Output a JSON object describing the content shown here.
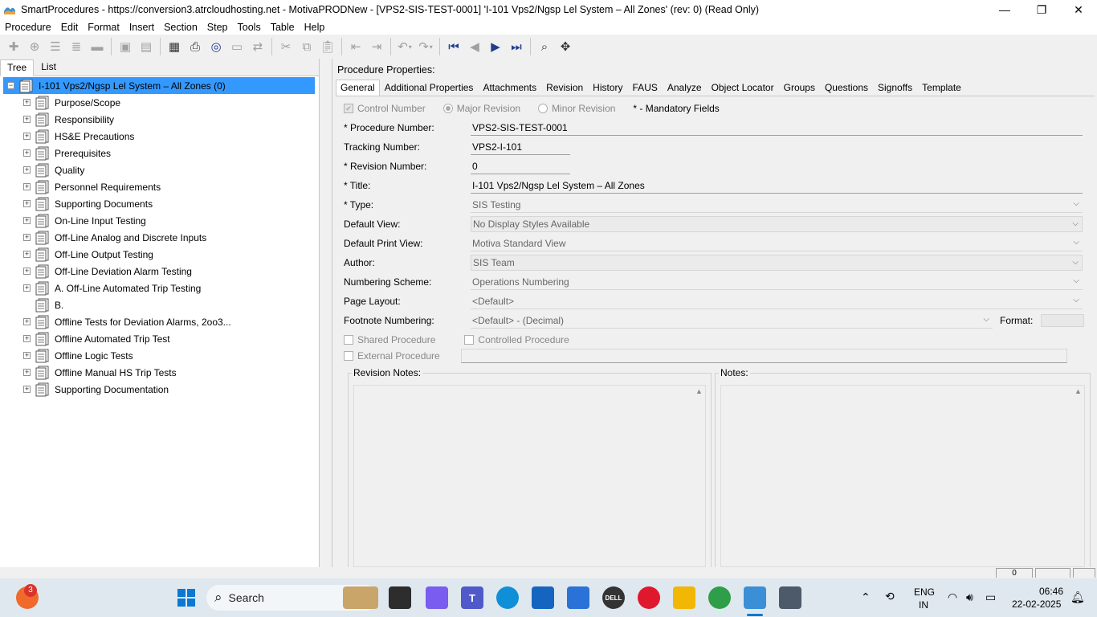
{
  "window": {
    "title": "SmartProcedures - https://conversion3.atrcloudhosting.net - MotivaPRODNew - [VPS2-SIS-TEST-0001] 'I-101 Vps2/Ngsp Lel System – All Zones' (rev: 0) (Read Only)",
    "minimize": "—",
    "restore": "❐",
    "close": "✕"
  },
  "menu": [
    "Procedure",
    "Edit",
    "Format",
    "Insert",
    "Section",
    "Step",
    "Tools",
    "Table",
    "Help"
  ],
  "left": {
    "tabs": [
      "Tree",
      "List"
    ],
    "root": "I-101 Vps2/Ngsp Lel System – All Zones (0)",
    "items": [
      "Purpose/Scope",
      "Responsibility",
      "HS&E Precautions",
      "Prerequisites",
      "Quality",
      "Personnel Requirements",
      "Supporting Documents",
      "On-Line Input Testing",
      "Off-Line Analog and Discrete Inputs",
      "Off-Line Output Testing",
      "Off-Line Deviation Alarm Testing",
      "A. Off-Line Automated Trip Testing",
      "B.",
      "Offline Tests for Deviation Alarms, 2oo3...",
      "Offline Automated Trip Test",
      "Offline Logic Tests",
      "Offline Manual HS Trip Tests",
      "Supporting Documentation"
    ]
  },
  "right": {
    "title": "Procedure Properties:",
    "tabs": [
      "General",
      "Additional Properties",
      "Attachments",
      "Revision",
      "History",
      "FAUS",
      "Analyze",
      "Object Locator",
      "Groups",
      "Questions",
      "Signoffs",
      "Template"
    ],
    "control_number": "Control Number",
    "major_revision": "Major Revision",
    "minor_revision": "Minor Revision",
    "mandatory": "* - Mandatory Fields",
    "procedure_number_label": "* Procedure Number:",
    "procedure_number": "VPS2-SIS-TEST-0001",
    "tracking_number_label": "Tracking Number:",
    "tracking_number": "VPS2-I-101",
    "revision_number_label": "* Revision Number:",
    "revision_number": "0",
    "title_label": "* Title:",
    "title_value": "I-101 Vps2/Ngsp Lel System – All Zones",
    "type_label": "* Type:",
    "type_value": "SIS Testing",
    "default_view_label": "Default View:",
    "default_view": "No Display Styles Available",
    "default_print_view_label": "Default Print View:",
    "default_print_view": "Motiva Standard View",
    "author_label": "Author:",
    "author": "SIS Team",
    "numbering_scheme_label": "Numbering Scheme:",
    "numbering_scheme": "Operations Numbering",
    "page_layout_label": "Page Layout:",
    "page_layout": "<Default>",
    "footnote_numbering_label": "Footnote Numbering:",
    "footnote_numbering": "<Default> - (Decimal)",
    "format_label": "Format:",
    "shared_procedure": "Shared Procedure",
    "controlled_procedure": "Controlled Procedure",
    "external_procedure": "External Procedure",
    "revision_notes": "Revision Notes:",
    "notes": "Notes:"
  },
  "status": {
    "count": "0"
  },
  "taskbar": {
    "search": "Search",
    "notifications": "3",
    "lang": "ENG",
    "region": "IN",
    "time": "06:46",
    "date": "22-02-2025"
  }
}
